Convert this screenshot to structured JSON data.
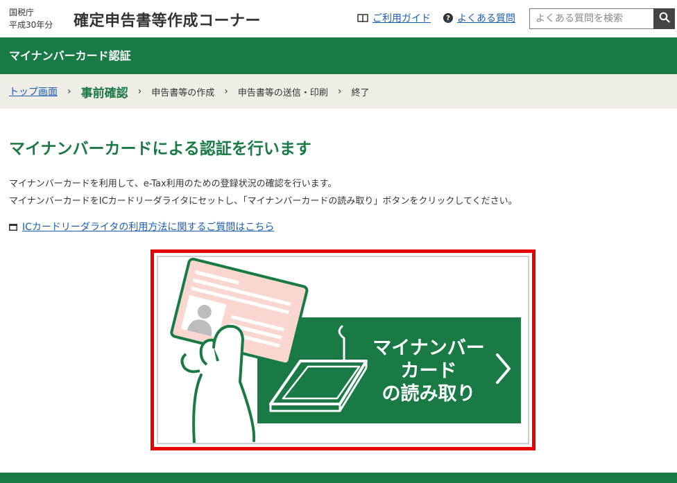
{
  "header": {
    "agency_line1": "国税庁",
    "agency_line2": "平成30年分",
    "site_title": "確定申告書等作成コーナー",
    "guide_link": "ご利用ガイド",
    "faq_link": "よくある質問",
    "search_placeholder": "よくある質問を検索"
  },
  "section_bar": {
    "title": "マイナンバーカード認証"
  },
  "breadcrumb": {
    "items": [
      "トップ画面",
      "事前確認",
      "申告書等の作成",
      "申告書等の送信・印刷",
      "終了"
    ],
    "current_index": 1
  },
  "main": {
    "heading": "マイナンバーカードによる認証を行います",
    "desc_line1": "マイナンバーカードを利用して、e-Tax利用のための登録状況の確認を行います。",
    "desc_line2": "マイナンバーカードをICカードリーダライタにセットし、「マイナンバーカードの読み取り」ボタンをクリックしてください。",
    "help_link": "ICカードリーダライタの利用方法に関するご質問はこちら",
    "read_button_line1": "マイナンバー",
    "read_button_line2": "カード",
    "read_button_line3": "の読み取り"
  },
  "colors": {
    "brand_green": "#1a7a45",
    "link_blue": "#1a5fb4",
    "highlight_red": "#e60000",
    "breadcrumb_bg": "#efede6",
    "card_pink": "#f9d6cf"
  },
  "icons": [
    "book-icon",
    "question-icon",
    "search-icon",
    "window-icon",
    "chevron-right-icon",
    "mynumber-card-illustration",
    "card-reader-illustration"
  ]
}
